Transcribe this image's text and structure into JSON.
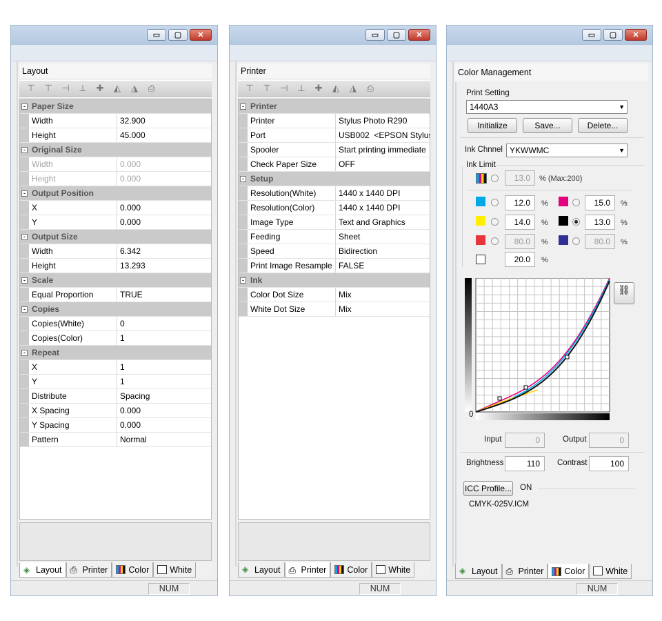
{
  "windows": {
    "title_buttons": {
      "minimize": "▭",
      "maximize": "▢",
      "close": "✕"
    },
    "status_num": "NUM",
    "tabs": [
      "Layout",
      "Printer",
      "Color",
      "White"
    ]
  },
  "layout": {
    "caption": "Layout",
    "groups": [
      {
        "name": "Paper Size",
        "rows": [
          {
            "name": "Width",
            "value": "32.900",
            "disabled": false
          },
          {
            "name": "Height",
            "value": "45.000",
            "disabled": false
          }
        ]
      },
      {
        "name": "Original Size",
        "rows": [
          {
            "name": "Width",
            "value": "0.000",
            "disabled": true
          },
          {
            "name": "Height",
            "value": "0.000",
            "disabled": true
          }
        ]
      },
      {
        "name": "Output Position",
        "rows": [
          {
            "name": "X",
            "value": "0.000",
            "disabled": false
          },
          {
            "name": "Y",
            "value": "0.000",
            "disabled": false
          }
        ]
      },
      {
        "name": "Output Size",
        "rows": [
          {
            "name": "Width",
            "value": "6.342",
            "disabled": false
          },
          {
            "name": "Height",
            "value": "13.293",
            "disabled": false
          }
        ]
      },
      {
        "name": "Scale",
        "rows": [
          {
            "name": "Equal Proportion",
            "value": "TRUE",
            "disabled": false
          }
        ]
      },
      {
        "name": "Copies",
        "rows": [
          {
            "name": "Copies(White)",
            "value": "0",
            "disabled": false
          },
          {
            "name": "Copies(Color)",
            "value": "1",
            "disabled": false
          }
        ]
      },
      {
        "name": "Repeat",
        "rows": [
          {
            "name": "X",
            "value": "1",
            "disabled": false
          },
          {
            "name": "Y",
            "value": "1",
            "disabled": false
          },
          {
            "name": "Distribute",
            "value": "Spacing",
            "disabled": false
          },
          {
            "name": "X Spacing",
            "value": "0.000",
            "disabled": false
          },
          {
            "name": "Y Spacing",
            "value": "0.000",
            "disabled": false
          },
          {
            "name": "Pattern",
            "value": "Normal",
            "disabled": false
          }
        ]
      }
    ]
  },
  "printer": {
    "caption": "Printer",
    "groups": [
      {
        "name": "Printer",
        "rows": [
          {
            "name": "Printer",
            "value": "Stylus Photo R290",
            "disabled": false
          },
          {
            "name": "Port",
            "value": "USB002  <EPSON Stylus",
            "disabled": false
          },
          {
            "name": "Spooler",
            "value": "Start printing immediate",
            "disabled": false
          },
          {
            "name": "Check Paper Size",
            "value": "OFF",
            "disabled": false
          }
        ]
      },
      {
        "name": "Setup",
        "rows": [
          {
            "name": "Resolution(White)",
            "value": "1440 x 1440 DPI",
            "disabled": false
          },
          {
            "name": "Resolution(Color)",
            "value": "1440 x 1440 DPI",
            "disabled": false
          },
          {
            "name": "Image Type",
            "value": "Text and Graphics",
            "disabled": false
          },
          {
            "name": "Feeding",
            "value": "Sheet",
            "disabled": false
          },
          {
            "name": "Speed",
            "value": "Bidirection",
            "disabled": false
          },
          {
            "name": "Print Image Resample",
            "value": "FALSE",
            "disabled": false
          }
        ]
      },
      {
        "name": "Ink",
        "rows": [
          {
            "name": "Color Dot Size",
            "value": "Mix",
            "disabled": false
          },
          {
            "name": "White Dot Size",
            "value": "Mix",
            "disabled": false
          }
        ]
      }
    ]
  },
  "color": {
    "caption": "Color Management",
    "print_setting_label": "Print Setting",
    "print_setting_value": "1440A3",
    "buttons": {
      "initialize": "Initialize",
      "save": "Save...",
      "delete": "Delete..."
    },
    "ink_channel_label": "Ink Chnnel",
    "ink_channel_value": "YKWWMC",
    "ink_limit_label": "Ink Limit",
    "total_value": "13.0",
    "total_suffix": "% (Max:200)",
    "pct": "%",
    "inks": {
      "cyan": "12.0",
      "magenta": "15.0",
      "yellow": "14.0",
      "black": "13.0",
      "red": "80.0",
      "blue": "80.0",
      "white": "20.0"
    },
    "swatch_colors": {
      "cyan": "#00a9e6",
      "magenta": "#e4007f",
      "yellow": "#ffee00",
      "black": "#000000",
      "red": "#e8343c",
      "blue": "#2e3192",
      "white": "#ffffff"
    },
    "curve_zero": "0",
    "input_label": "Input",
    "input_value": "0",
    "output_label": "Output",
    "output_value": "0",
    "brightness_label": "Brightness",
    "brightness_value": "110",
    "contrast_label": "Contrast",
    "contrast_value": "100",
    "icc_button": "ICC Profile...",
    "icc_state": "ON",
    "icc_file": "CMYK-025V.ICM"
  }
}
